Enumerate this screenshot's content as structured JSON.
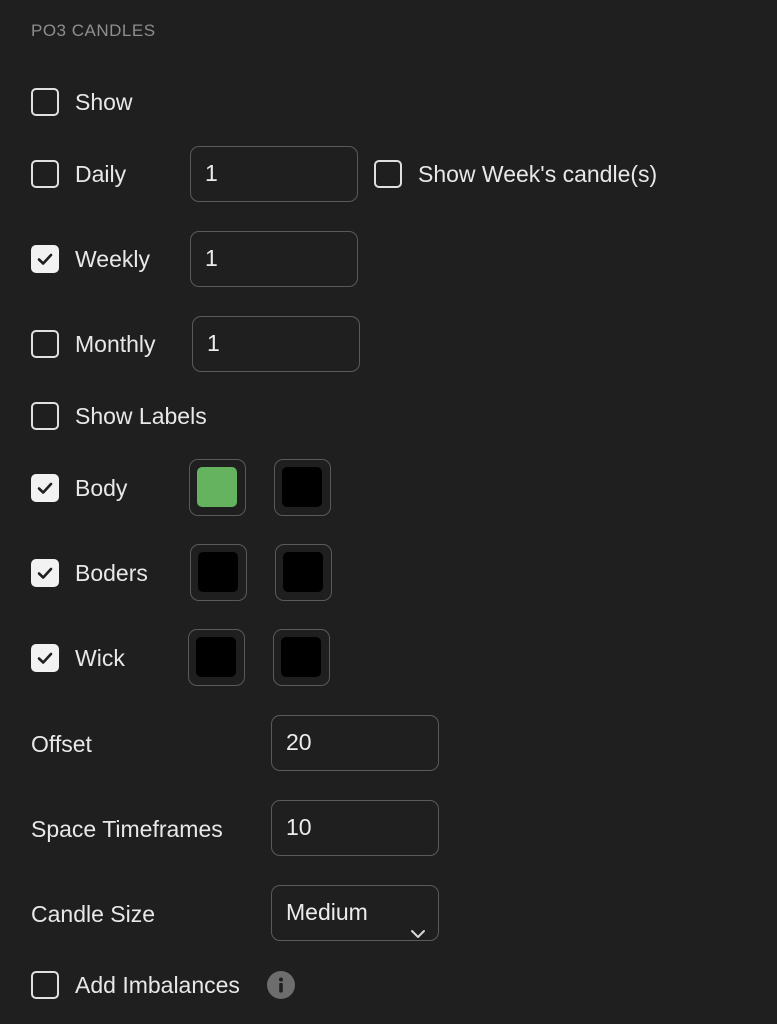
{
  "section_title": "PO3 CANDLES",
  "show": {
    "label": "Show",
    "checked": false
  },
  "daily": {
    "label": "Daily",
    "checked": false,
    "value": "1"
  },
  "show_week_candles": {
    "label": "Show Week's candle(s)",
    "checked": false
  },
  "weekly": {
    "label": "Weekly",
    "checked": true,
    "value": "1"
  },
  "monthly": {
    "label": "Monthly",
    "checked": false,
    "value": "1"
  },
  "show_labels": {
    "label": "Show Labels",
    "checked": false
  },
  "body": {
    "label": "Body",
    "checked": true,
    "colors": [
      "#66b35f",
      "#000000"
    ]
  },
  "borders": {
    "label": "Boders",
    "checked": true,
    "colors": [
      "#000000",
      "#000000"
    ]
  },
  "wick": {
    "label": "Wick",
    "checked": true,
    "colors": [
      "#000000",
      "#000000"
    ]
  },
  "offset": {
    "label": "Offset",
    "value": "20"
  },
  "space_timeframes": {
    "label": "Space Timeframes",
    "value": "10"
  },
  "candle_size": {
    "label": "Candle Size",
    "value": "Medium"
  },
  "add_imbalances": {
    "label": "Add Imbalances",
    "checked": false,
    "info_icon": "info-icon"
  }
}
